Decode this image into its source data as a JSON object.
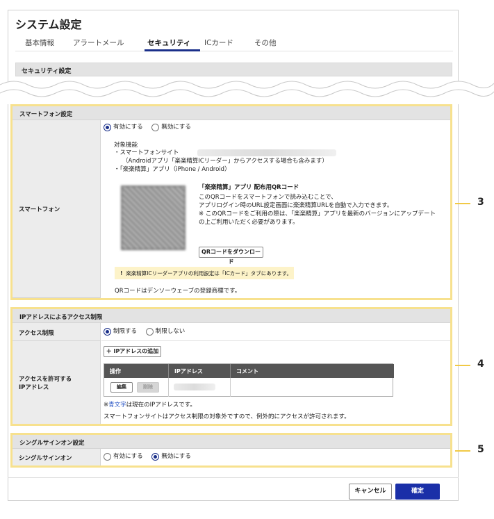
{
  "app": {
    "title": "システム設定"
  },
  "tabs": [
    "基本情報",
    "アラートメール",
    "セキュリティ",
    "ICカード",
    "その他"
  ],
  "security_section": {
    "title": "セキュリティ設定"
  },
  "smartphone_section": {
    "title": "スマートフォン設定",
    "label": "スマートフォン",
    "radio_on": "有効にする",
    "radio_off": "無効にする",
    "features_title": "対象機能",
    "feature1": "・スマートフォンサイト",
    "feature1_note": "（Androidアプリ「楽楽精算ICリーダー」からアクセスする場合も含みます）",
    "feature2": "・「楽楽精算」アプリ（iPhone / Android）",
    "qr_title": "「楽楽精算」アプリ 配布用QRコード",
    "qr_desc1": "このQRコードをスマートフォンで読み込むことで、",
    "qr_desc2": "アプリログイン時のURL設定画面に楽楽精算URLを自動で入力できます。",
    "qr_desc3": "※ このQRコードをご利用の際は、「楽楽精算」アプリを最新のバージョンにアップデート",
    "qr_desc4": "の上ご利用いただく必要があります。",
    "download_button": "QRコードをダウンロード",
    "notice_mark": "!",
    "notice": "楽楽精算ICリーダーアプリの利用設定は「ICカード」タブにあります。",
    "trademark": "QRコードはデンソーウェーブの登録商標です。"
  },
  "ip_section": {
    "title": "IPアドレスによるアクセス制限",
    "access_label": "アクセス制限",
    "radio_on": "制限する",
    "radio_off": "制限しない",
    "allowed_label_1": "アクセスを許可する",
    "allowed_label_2": "IPアドレス",
    "add_button": "＋ IPアドレスの追加",
    "columns": [
      "操作",
      "IPアドレス",
      "コメント"
    ],
    "edit_button": "編集",
    "delete_button": "削除",
    "blue_note_prefix": "※",
    "blue_note_link": "青文字",
    "blue_note_suffix": "は現在のIPアドレスです。",
    "exempt_note": "スマートフォンサイトはアクセス制限の対象外ですので、例外的にアクセスが許可されます。"
  },
  "sso_section": {
    "title": "シングルサインオン設定",
    "label": "シングルサインオン",
    "radio_enable": "有効にする",
    "radio_disable": "無効にする"
  },
  "callouts": [
    "3",
    "4",
    "5"
  ],
  "footer": {
    "cancel": "キャンセル",
    "confirm": "確定"
  },
  "colors": {
    "accent": "#1a2f8a",
    "highlight": "#f7e18e",
    "notice_bg": "#fdf3c9",
    "link": "#2a56c6"
  }
}
